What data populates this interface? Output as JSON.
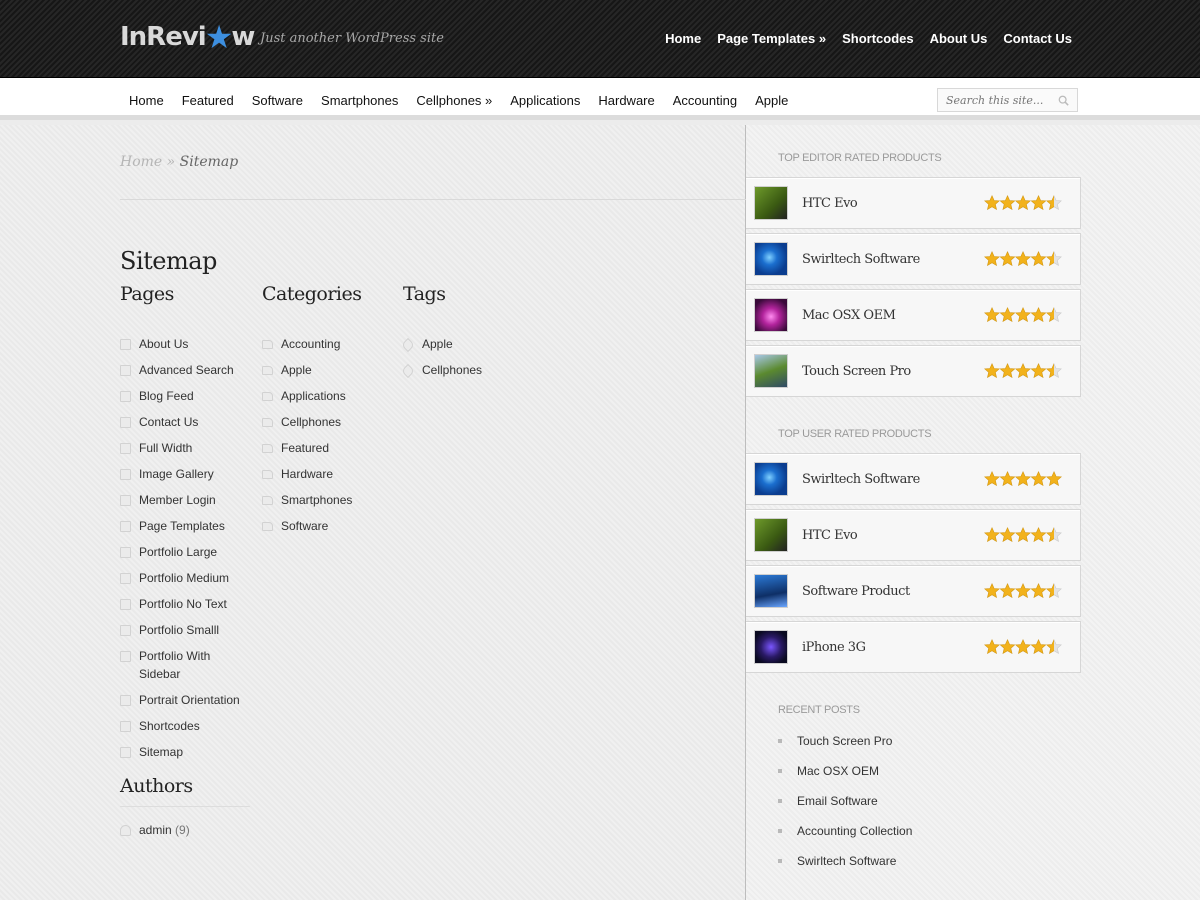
{
  "header": {
    "logo_text_a": "InRevi",
    "logo_text_b": "w",
    "tagline": "Just another WordPress site",
    "nav": [
      "Home",
      "Page Templates »",
      "Shortcodes",
      "About Us",
      "Contact Us"
    ]
  },
  "catnav": [
    "Home",
    "Featured",
    "Software",
    "Smartphones",
    "Cellphones »",
    "Applications",
    "Hardware",
    "Accounting",
    "Apple"
  ],
  "search": {
    "placeholder": "Search this site..."
  },
  "breadcrumb": {
    "home": "Home",
    "sep": " » ",
    "current": "Sitemap"
  },
  "page_title": "Sitemap",
  "columns": {
    "pages": {
      "title": "Pages",
      "items": [
        "About Us",
        "Advanced Search",
        "Blog Feed",
        "Contact Us",
        "Full Width",
        "Image Gallery",
        "Member Login",
        "Page Templates",
        "Portfolio Large",
        "Portfolio Medium",
        "Portfolio No Text",
        "Portfolio Smalll",
        "Portfolio With Sidebar",
        "Portrait Orientation",
        "Shortcodes",
        "Sitemap"
      ]
    },
    "categories": {
      "title": "Categories",
      "items": [
        "Accounting",
        "Apple",
        "Applications",
        "Cellphones",
        "Featured",
        "Hardware",
        "Smartphones",
        "Software"
      ]
    },
    "tags": {
      "title": "Tags",
      "items": [
        "Apple",
        "Cellphones"
      ]
    }
  },
  "authors": {
    "title": "Authors",
    "items": [
      {
        "name": "admin",
        "count": "(9)"
      }
    ]
  },
  "sidebar": {
    "editor_title": "Top Editor Rated Products",
    "editor_products": [
      {
        "name": "HTC Evo",
        "rating": 4.5,
        "thumb": "th1"
      },
      {
        "name": "Swirltech Software",
        "rating": 4.5,
        "thumb": "th2"
      },
      {
        "name": "Mac OSX OEM",
        "rating": 4.5,
        "thumb": "th3"
      },
      {
        "name": "Touch Screen Pro",
        "rating": 4.5,
        "thumb": "th4"
      }
    ],
    "user_title": "Top User Rated Products",
    "user_products": [
      {
        "name": "Swirltech Software",
        "rating": 5,
        "thumb": "th2"
      },
      {
        "name": "HTC Evo",
        "rating": 4.5,
        "thumb": "th1"
      },
      {
        "name": "Software Product",
        "rating": 4.5,
        "thumb": "th5"
      },
      {
        "name": "iPhone 3G",
        "rating": 4.5,
        "thumb": "th6"
      }
    ],
    "recent_title": "Recent Posts",
    "recent_posts": [
      "Touch Screen Pro",
      "Mac OSX OEM",
      "Email Software",
      "Accounting Collection",
      "Swirltech Software"
    ]
  },
  "colors": {
    "star_fill": "#f2b21b",
    "star_empty": "#e3e3e3",
    "logo_star": "#3d8fe0"
  }
}
